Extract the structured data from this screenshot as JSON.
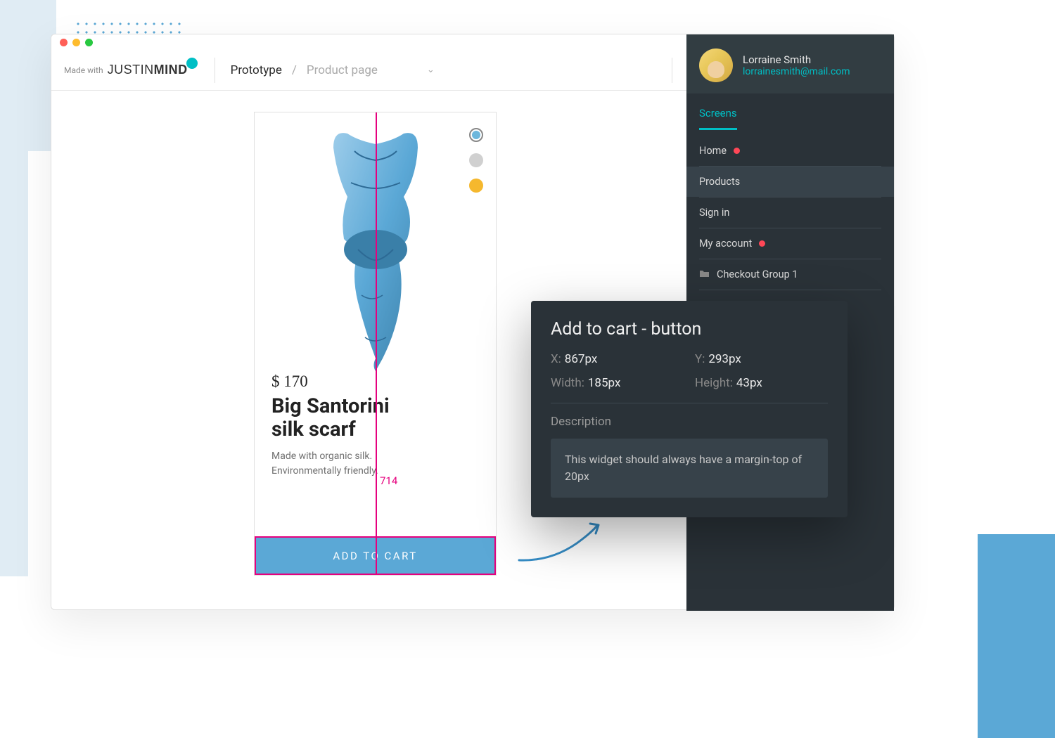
{
  "header": {
    "made_with": "Made with",
    "logo_justin": "JUSTIN",
    "logo_mind": "MIND",
    "breadcrumb1": "Prototype",
    "breadcrumb_sep": "/",
    "breadcrumb2": "Product page"
  },
  "product": {
    "price": "$ 170",
    "title_line1": "Big Santorini",
    "title_line2": "silk scarf",
    "ruler_label": "714",
    "desc1": "Made with organic silk.",
    "desc2": "Environmentally friendly.",
    "cart_button": "ADD TO CART"
  },
  "sidebar": {
    "user_name": "Lorraine Smith",
    "user_email": "lorrainesmith@mail.com",
    "tab": "Screens",
    "items": [
      {
        "label": "Home",
        "red": true
      },
      {
        "label": "Products",
        "red": false
      },
      {
        "label": "Sign in",
        "red": false
      },
      {
        "label": "My account",
        "red": true
      },
      {
        "label": "Checkout Group 1",
        "red": false,
        "folder": true
      }
    ]
  },
  "popup": {
    "title": "Add to cart - button",
    "x_label": "X:",
    "x_val": "867px",
    "y_label": "Y:",
    "y_val": "293px",
    "w_label": "Width:",
    "w_val": "185px",
    "h_label": "Height:",
    "h_val": "43px",
    "desc_label": "Description",
    "desc_text": "This widget should always have a margin-top of 20px"
  }
}
